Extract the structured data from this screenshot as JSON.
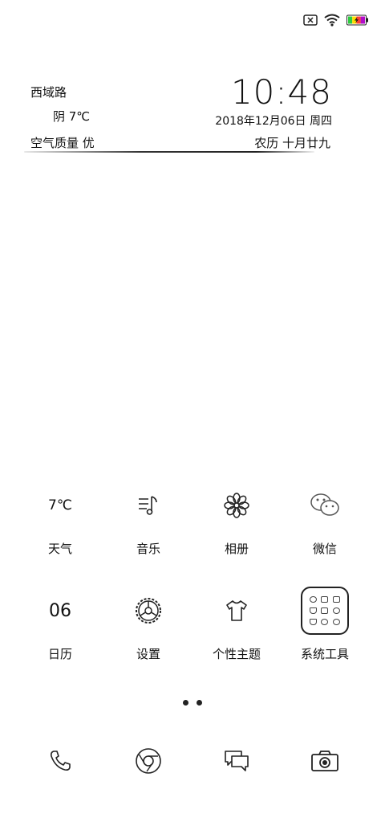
{
  "status_bar": {
    "icons": [
      "no-sim-icon",
      "wifi-icon",
      "battery-charging-icon"
    ],
    "battery_colors": [
      "#2ecc40",
      "#ffdc00",
      "#ff4136",
      "#b10dc9"
    ]
  },
  "widget": {
    "location": "西域路",
    "weather": "阴 7℃",
    "air_quality": "空气质量 优",
    "time": "10:48",
    "date": "2018年12月06日 周四",
    "lunar": "农历 十月廿九"
  },
  "apps": [
    {
      "label": "天气",
      "icon": "weather-icon",
      "icon_text": "7℃"
    },
    {
      "label": "音乐",
      "icon": "music-icon"
    },
    {
      "label": "相册",
      "icon": "gallery-flower-icon"
    },
    {
      "label": "微信",
      "icon": "wechat-icon"
    },
    {
      "label": "日历",
      "icon": "calendar-icon",
      "icon_text": "06"
    },
    {
      "label": "设置",
      "icon": "settings-gear-icon"
    },
    {
      "label": "个性主题",
      "icon": "theme-shirt-icon"
    },
    {
      "label": "系统工具",
      "icon": "system-tools-folder-icon"
    }
  ],
  "page_indicator": {
    "pages": 2
  },
  "dock": [
    {
      "icon": "phone-icon"
    },
    {
      "icon": "browser-icon"
    },
    {
      "icon": "messages-icon"
    },
    {
      "icon": "camera-icon"
    }
  ]
}
